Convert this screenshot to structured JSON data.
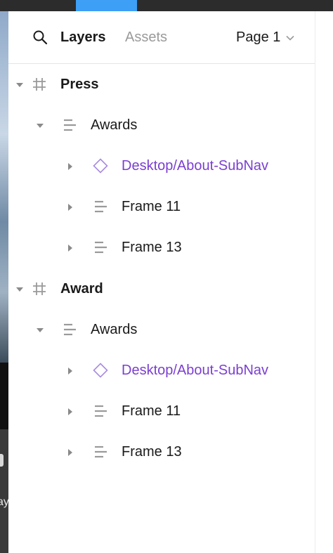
{
  "header": {
    "tabs": [
      {
        "label": "Layers",
        "active": true
      },
      {
        "label": "Assets",
        "active": false
      }
    ],
    "page_select": "Page 1"
  },
  "colors": {
    "component": "#7b3fd0",
    "accent": "#3d9ff5",
    "muted": "#9a9a9a"
  },
  "canvas_fragment_text": "ay",
  "layers": [
    {
      "label": "Press",
      "icon": "frame-hash-icon",
      "expanded": true
    },
    {
      "label": "Awards",
      "icon": "auto-layout-icon",
      "expanded": true
    },
    {
      "label": "Desktop/About-SubNav",
      "icon": "component-instance-icon",
      "expanded": false
    },
    {
      "label": "Frame 11",
      "icon": "auto-layout-icon",
      "expanded": false
    },
    {
      "label": "Frame 13",
      "icon": "auto-layout-icon",
      "expanded": false
    },
    {
      "label": "Award",
      "icon": "frame-hash-icon",
      "expanded": true
    },
    {
      "label": "Awards",
      "icon": "auto-layout-icon",
      "expanded": true
    },
    {
      "label": "Desktop/About-SubNav",
      "icon": "component-instance-icon",
      "expanded": false
    },
    {
      "label": "Frame 11",
      "icon": "auto-layout-icon",
      "expanded": false
    },
    {
      "label": "Frame 13",
      "icon": "auto-layout-icon",
      "expanded": false
    }
  ]
}
